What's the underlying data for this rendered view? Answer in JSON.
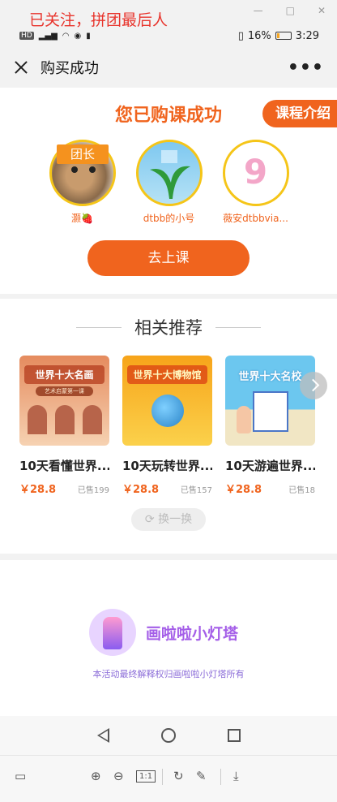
{
  "overlay_banner": "已关注，拼团最后人",
  "status_bar": {
    "network": "HD",
    "battery": "16%",
    "battery_level": 0.16,
    "time": "3:29"
  },
  "app_bar": {
    "title": "购买成功",
    "close_icon": "close-icon",
    "more_icon": "more-dots-icon"
  },
  "success": {
    "title": "您已购课成功",
    "intro_label": "课程介绍",
    "leader_badge": "团长",
    "members": [
      {
        "name": "灏🍓",
        "avatar": "cat-photo"
      },
      {
        "name": "dtbb的小号",
        "avatar": "leaf-landscape"
      },
      {
        "name": "薇安dtbbvia...",
        "avatar": "number-nine"
      }
    ],
    "go_class_label": "去上课"
  },
  "recommend": {
    "title": "相关推荐",
    "items": [
      {
        "cover_title": "世界十大名画",
        "cover_subtitle": "艺术启蒙第一课",
        "name": "10天看懂世界...",
        "price": "￥28.8",
        "sold": "已售199"
      },
      {
        "cover_title": "世界十大博物馆",
        "name": "10天玩转世界...",
        "price": "￥28.8",
        "sold": "已售157"
      },
      {
        "cover_title": "世界十大名校",
        "name": "10天游遍世界...",
        "price": "￥28.8",
        "sold": "已售18"
      }
    ],
    "swap_label": "换一换"
  },
  "brand": {
    "name": "画啦啦小灯塔",
    "note": "本活动最终解释权归画啦啦小灯塔所有"
  },
  "viewer_bar": {
    "zoom_reset_label": "1:1"
  },
  "colors": {
    "accent": "#f0641e",
    "brand_purple": "#a45ee8",
    "avatar_ring": "#f5c518"
  }
}
